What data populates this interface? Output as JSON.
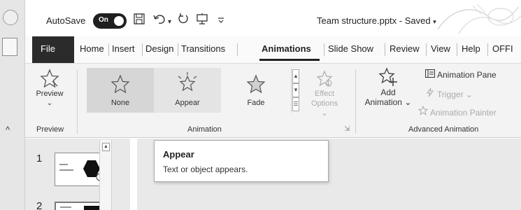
{
  "titlebar": {
    "autosave_label": "AutoSave",
    "toggle_state": "On",
    "document_title": "Team structure.pptx",
    "title_separator": "-",
    "save_status": "Saved",
    "save_dropdown": "▾",
    "quick_access_icons": [
      "save-icon",
      "undo-icon",
      "redo-icon",
      "present-icon",
      "customize-icon"
    ],
    "qa_glyphs": {
      "save": "💾",
      "undo": "↶",
      "undo_dropdown": "▾",
      "redo": "↻",
      "present": "⊞",
      "customize": "⊽"
    }
  },
  "tabs": {
    "items": [
      {
        "label": "File"
      },
      {
        "label": "Home"
      },
      {
        "label": "Insert"
      },
      {
        "label": "Design"
      },
      {
        "label": "Transitions"
      },
      {
        "label": "Animations"
      },
      {
        "label": "Slide Show"
      },
      {
        "label": "Review"
      },
      {
        "label": "View"
      },
      {
        "label": "Help"
      },
      {
        "label": "OFFI"
      }
    ],
    "active": "Animations"
  },
  "ribbon": {
    "preview": {
      "label": "Preview",
      "dropdown": "⌄",
      "group_label": "Preview"
    },
    "animation_group": {
      "label": "Animation",
      "gallery": [
        {
          "label": "None",
          "icon": "star-outline-icon",
          "selected": true
        },
        {
          "label": "Appear",
          "icon": "star-burst-icon",
          "selected": false
        },
        {
          "label": "Fade",
          "icon": "star-fade-icon",
          "selected": false
        }
      ],
      "effect_options": {
        "line1": "Effect",
        "line2": "Options",
        "dropdown": "⌄"
      },
      "launcher": "⇲"
    },
    "advanced_group": {
      "label": "Advanced Animation",
      "add_animation": {
        "line1": "Add",
        "line2": "Animation",
        "dropdown": "⌄"
      },
      "animation_pane": "Animation Pane",
      "trigger": "Trigger",
      "trigger_dropdown": "⌄",
      "animation_painter": "Animation Painter"
    },
    "collapse_caret": "^"
  },
  "slides": {
    "numbers": [
      "1",
      "2"
    ]
  },
  "tooltip": {
    "title": "Appear",
    "description": "Text or object appears."
  },
  "colors": {
    "file_tab_bg": "#2b2b2b",
    "ribbon_bg": "#f3f3f3",
    "selected_item_bg": "#d6d6d6",
    "toggle_bg": "#1f1f1f",
    "disabled_text": "#aaaaaa"
  }
}
